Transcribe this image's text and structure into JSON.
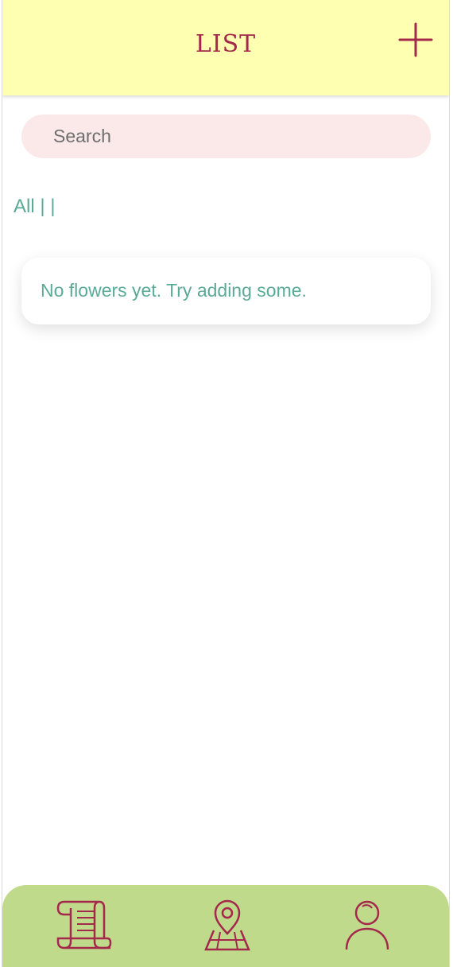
{
  "header": {
    "title": "LIST",
    "add_icon": "plus-icon"
  },
  "search": {
    "placeholder": "Search",
    "value": ""
  },
  "filters": {
    "text": "All | |"
  },
  "content": {
    "empty_message": "No flowers yet. Try adding some."
  },
  "bottom_nav": {
    "items": [
      {
        "icon": "scroll-icon"
      },
      {
        "icon": "map-pin-icon"
      },
      {
        "icon": "user-icon"
      }
    ]
  },
  "colors": {
    "header_bg": "#ffffb1",
    "accent": "#a3284b",
    "text_green": "#5aaa96",
    "search_bg": "#fbe9e9",
    "nav_bg": "#bfda8b"
  }
}
